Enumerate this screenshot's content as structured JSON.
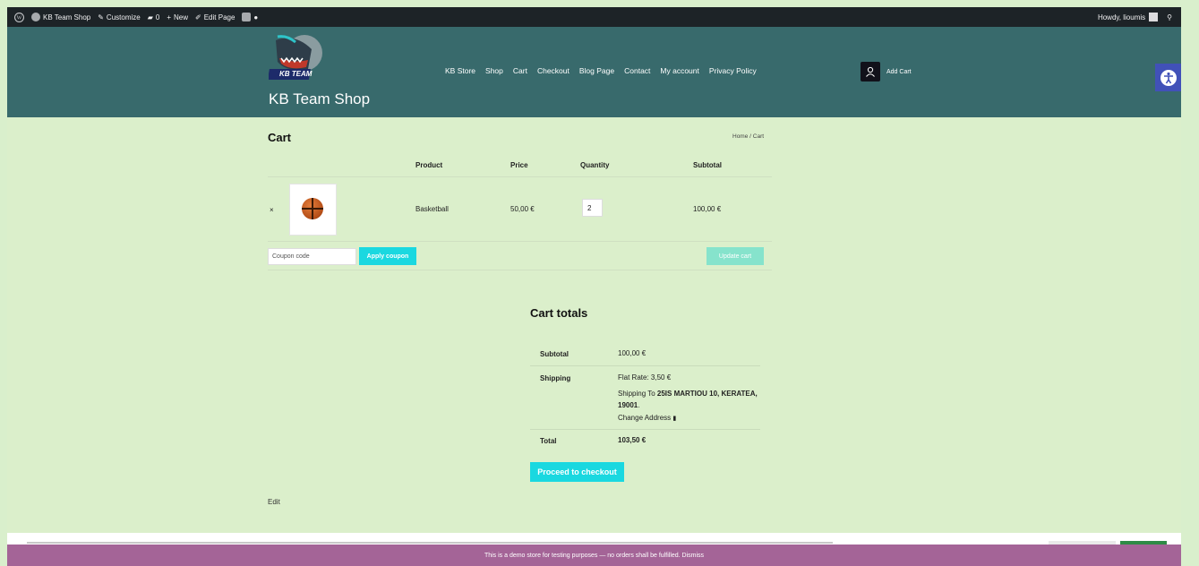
{
  "admin_bar": {
    "site_name": "KB Team Shop",
    "customize": "Customize",
    "comments_count": "0",
    "new": "New",
    "edit_page": "Edit Page",
    "howdy": "Howdy, lioumis"
  },
  "header": {
    "logo_text": "KB TEAM",
    "site_title": "KB Team Shop",
    "nav": [
      "KB Store",
      "Shop",
      "Cart",
      "Checkout",
      "Blog Page",
      "Contact",
      "My account",
      "Privacy Policy"
    ],
    "cart_label": "Add Cart"
  },
  "page": {
    "title": "Cart",
    "breadcrumb": "Home / Cart"
  },
  "cart_table": {
    "headers": [
      "Product",
      "Price",
      "Quantity",
      "Subtotal"
    ],
    "rows": [
      {
        "remove": "×",
        "product": "Basketball",
        "price": "50,00 €",
        "quantity": "2",
        "subtotal": "100,00 €"
      }
    ],
    "coupon_placeholder": "Coupon code",
    "apply_coupon": "Apply coupon",
    "update_cart": "Update cart"
  },
  "cart_totals": {
    "title": "Cart totals",
    "subtotal_label": "Subtotal",
    "subtotal": "100,00 €",
    "shipping_label": "Shipping",
    "flat_rate": "Flat Rate: 3,50 €",
    "shipping_to_prefix": "Shipping To ",
    "shipping_address": "25IS MARTIOU 10, KERATEA, 19001",
    "shipping_to_suffix": ".",
    "change_address": "Change Address",
    "total_label": "Total",
    "total": "103,50 €",
    "checkout_button": "Proceed to checkout"
  },
  "edit_link": "Edit",
  "demo_notice": "This is a demo store for testing purposes — no orders shall be fulfilled. Dismiss",
  "colors": {
    "header_bg": "#386a6c",
    "page_bg": "#dbefcb",
    "accent": "#1ad8e0",
    "demo_bar": "#a46497"
  }
}
